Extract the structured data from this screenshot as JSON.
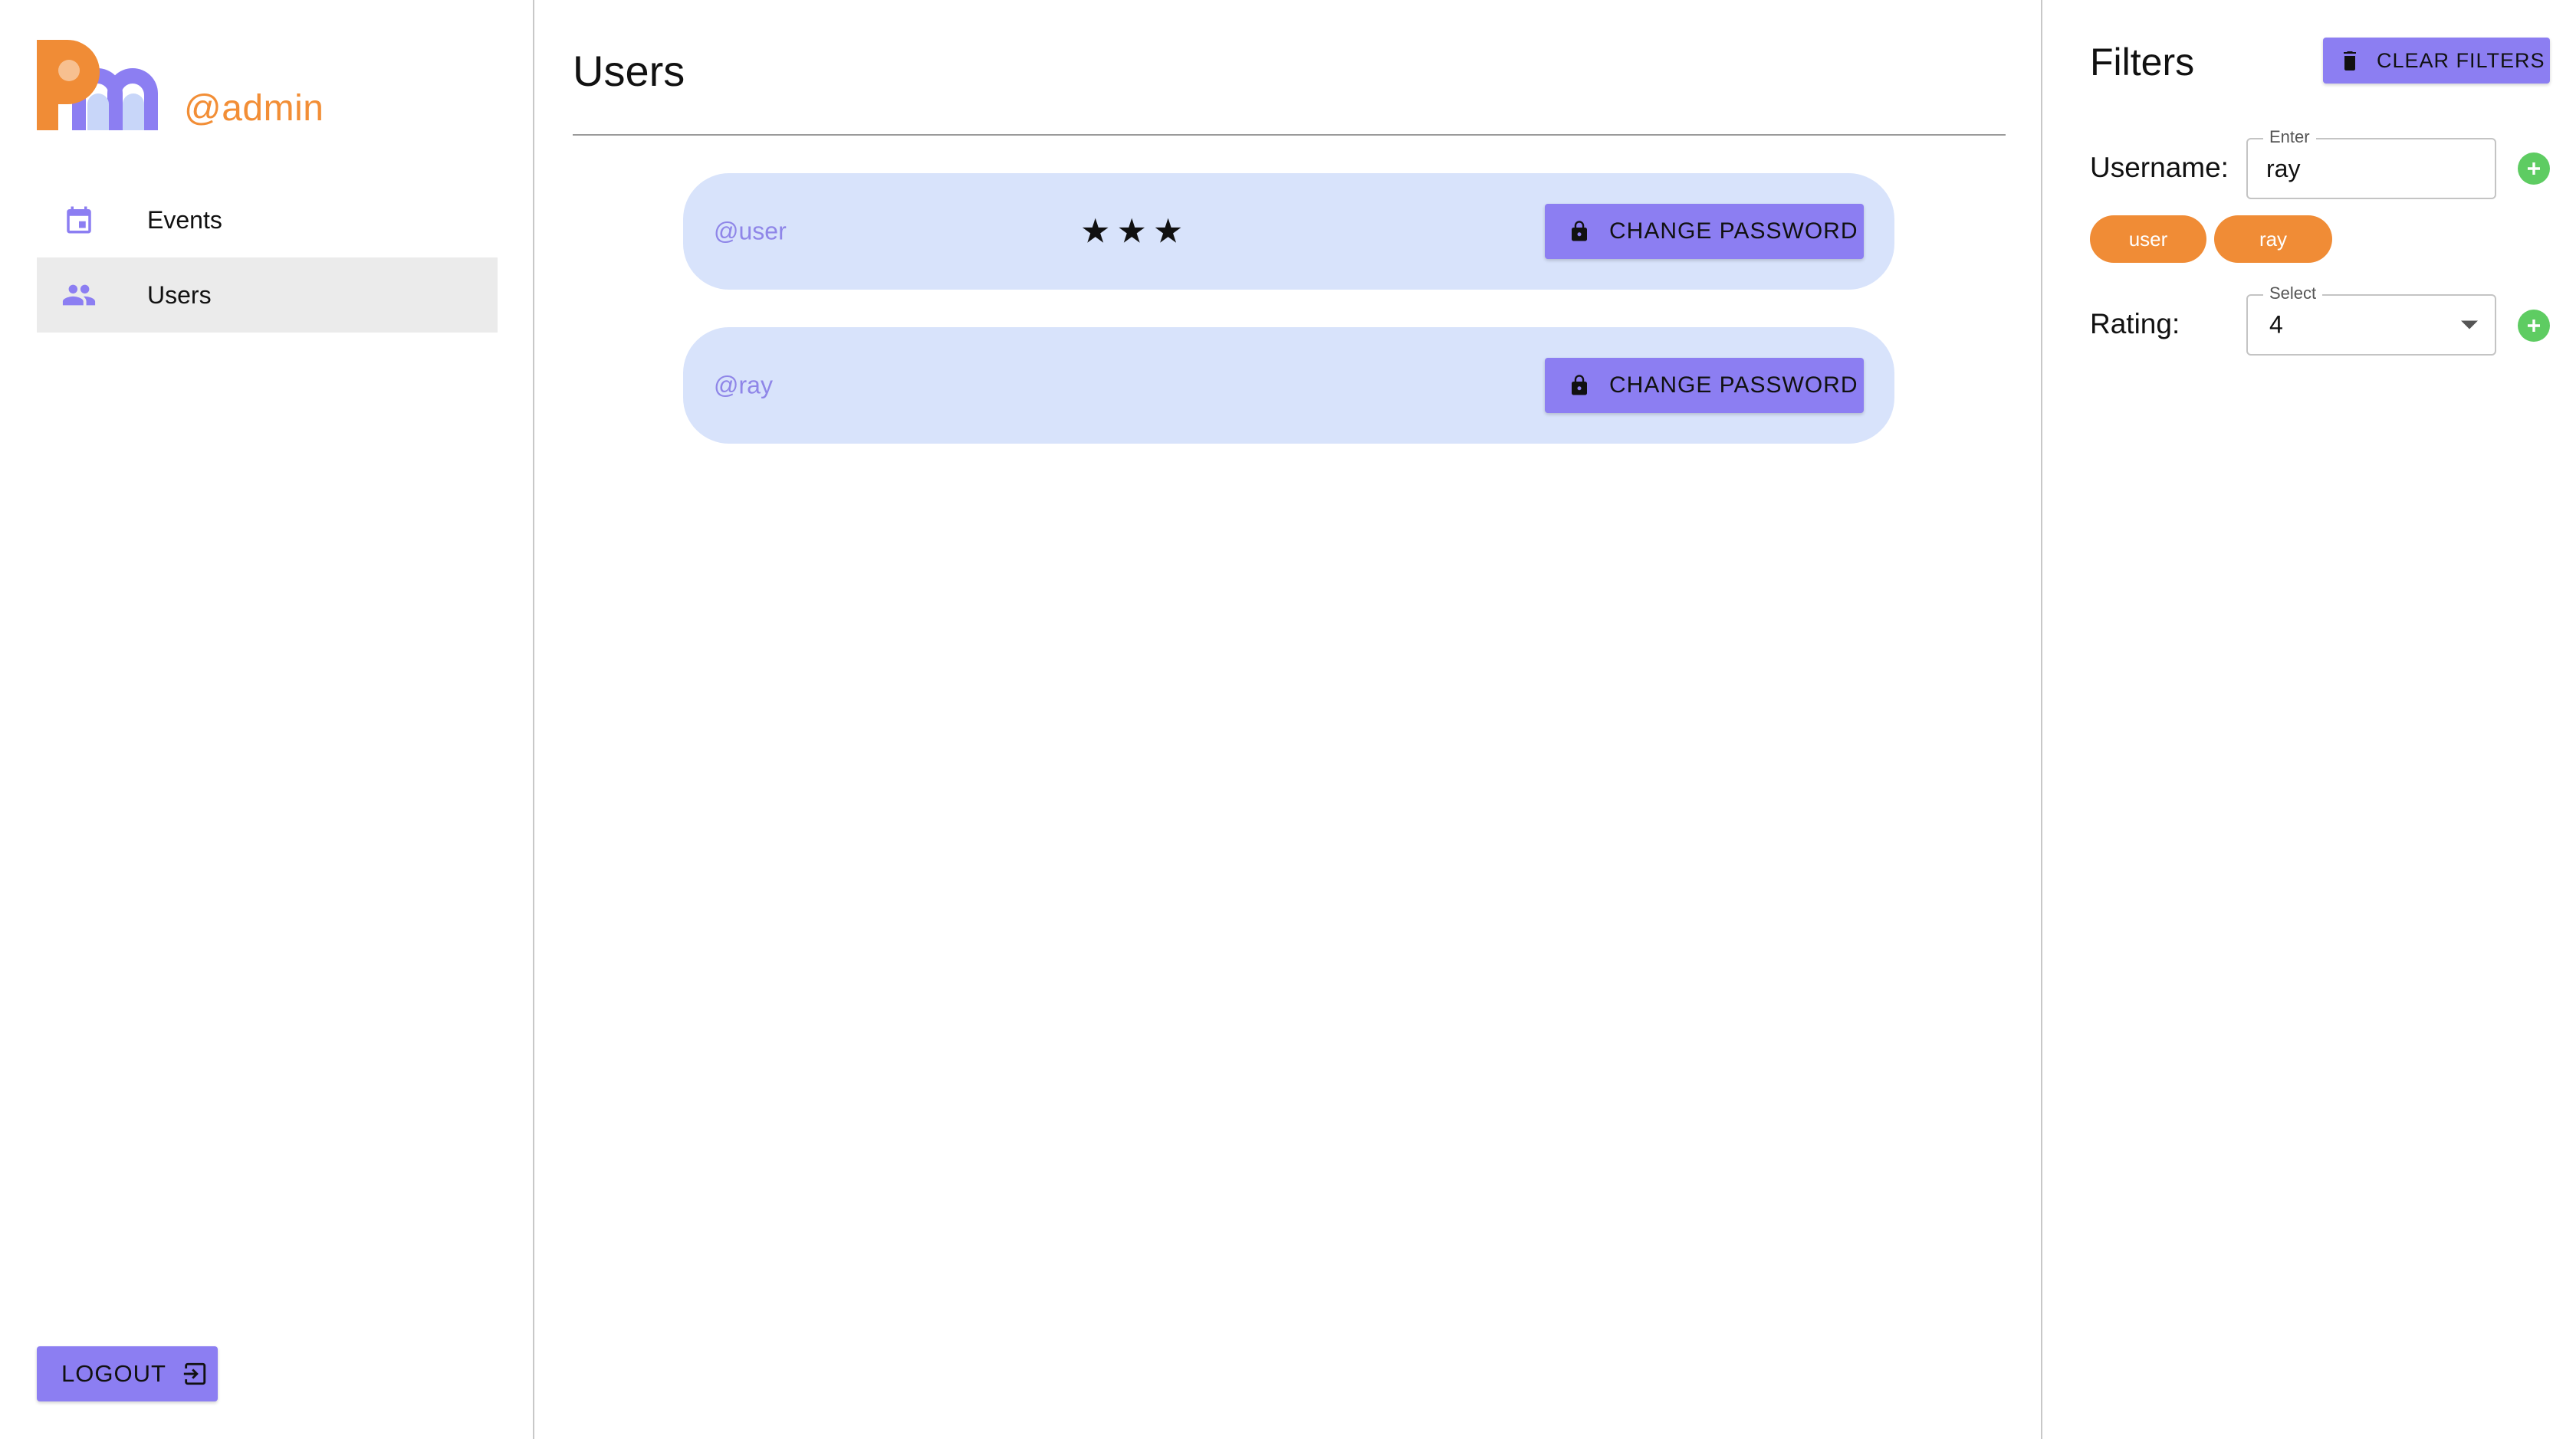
{
  "sidebar": {
    "username": "@admin",
    "logo_icon": "pm-logo",
    "items": [
      {
        "label": "Events",
        "icon": "calendar-icon",
        "active": false
      },
      {
        "label": "Users",
        "icon": "people-icon",
        "active": true
      }
    ],
    "logout_label": "LOGOUT",
    "logout_icon": "logout-icon"
  },
  "main": {
    "title": "Users",
    "users": [
      {
        "name": "@user",
        "rating_stars": "★★★",
        "rating": 3,
        "button_label": "CHANGE PASSWORD"
      },
      {
        "name": "@ray",
        "rating_stars": "",
        "rating": null,
        "button_label": "CHANGE PASSWORD"
      }
    ]
  },
  "filters": {
    "title": "Filters",
    "clear_label": "CLEAR FILTERS",
    "username_label": "Username:",
    "username_legend": "Enter",
    "username_value": "ray",
    "chips": [
      "user",
      "ray"
    ],
    "rating_label": "Rating:",
    "rating_legend": "Select",
    "rating_value": "4"
  },
  "colors": {
    "accent": "#8c7ef2",
    "brand_orange": "#f28e36",
    "card_bg": "#d8e3fb",
    "username_text": "#8f86e8",
    "add_green": "#5ecc62",
    "active_nav_bg": "#ebebeb"
  }
}
